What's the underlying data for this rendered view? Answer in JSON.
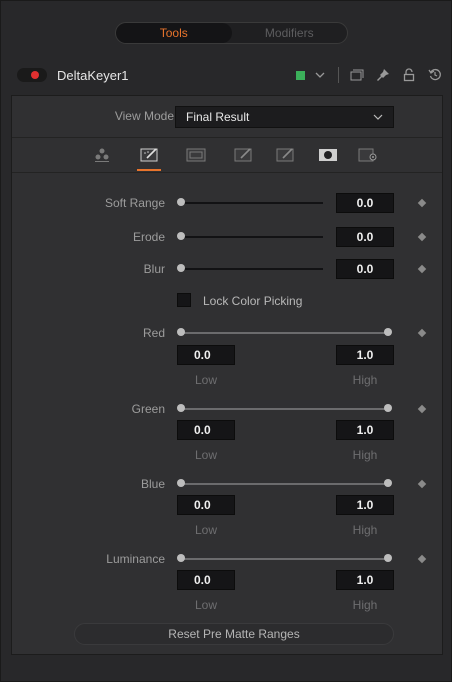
{
  "tabs": {
    "tools": "Tools",
    "modifiers": "Modifiers"
  },
  "tool": {
    "name": "DeltaKeyer1",
    "enabled_color": "#e03030",
    "swatch_color": "#3bb05a"
  },
  "view_mode": {
    "label": "View Mode",
    "value": "Final Result"
  },
  "controls": {
    "soft_range": {
      "label": "Soft Range",
      "value": "0.0"
    },
    "erode": {
      "label": "Erode",
      "value": "0.0"
    },
    "blur": {
      "label": "Blur",
      "value": "0.0"
    },
    "lock_color_picking": "Lock Color Picking",
    "red": {
      "label": "Red",
      "low": "0.0",
      "high": "1.0"
    },
    "green": {
      "label": "Green",
      "low": "0.0",
      "high": "1.0"
    },
    "blue": {
      "label": "Blue",
      "low": "0.0",
      "high": "1.0"
    },
    "luminance": {
      "label": "Luminance",
      "low": "0.0",
      "high": "1.0"
    },
    "low_label": "Low",
    "high_label": "High"
  },
  "reset_button": "Reset Pre Matte Ranges",
  "accent": "#e8742c"
}
